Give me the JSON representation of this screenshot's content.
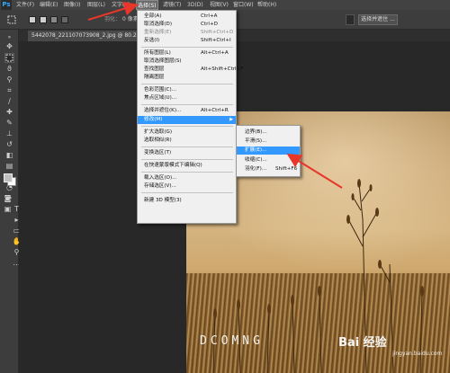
{
  "menubar": {
    "app_icon": "Ps",
    "items": [
      "文件(F)",
      "编辑(E)",
      "图像(I)",
      "图层(L)",
      "文字(Y)",
      "选择(S)",
      "滤镜(T)",
      "3D(D)",
      "视图(V)",
      "窗口(W)",
      "帮助(H)"
    ],
    "active_index": 5
  },
  "options_bar": {
    "feather_label": "羽化：",
    "feather_value": "0 像素",
    "select_and_mask_button": "选择并遮住 ..."
  },
  "document_tab": {
    "title": "5442078_221107073908_2.jpg @ 80.2..."
  },
  "select_menu": {
    "items": [
      {
        "label": "全部(A)",
        "shortcut": "Ctrl+A",
        "disabled": false
      },
      {
        "label": "取消选择(D)",
        "shortcut": "Ctrl+D",
        "disabled": false
      },
      {
        "label": "重新选择(E)",
        "shortcut": "Shift+Ctrl+D",
        "disabled": true
      },
      {
        "label": "反选(I)",
        "shortcut": "Shift+Ctrl+I",
        "disabled": false
      },
      {
        "label": "所有图层(L)",
        "shortcut": "Alt+Ctrl+A",
        "disabled": false
      },
      {
        "label": "取消选择图层(S)",
        "shortcut": "",
        "disabled": false
      },
      {
        "label": "查找图层",
        "shortcut": "Alt+Shift+Ctrl+F",
        "disabled": false
      },
      {
        "label": "隔离图层",
        "shortcut": "",
        "disabled": false
      },
      {
        "label": "色彩范围(C)...",
        "shortcut": "",
        "disabled": false
      },
      {
        "label": "焦点区域(U)...",
        "shortcut": "",
        "disabled": false
      },
      {
        "label": "选择并遮住(K)...",
        "shortcut": "Alt+Ctrl+R",
        "disabled": false
      },
      {
        "label": "修改(M)",
        "shortcut": "",
        "disabled": false,
        "submenu": true
      },
      {
        "label": "扩大选取(G)",
        "shortcut": "",
        "disabled": false
      },
      {
        "label": "选取相似(R)",
        "shortcut": "",
        "disabled": false
      },
      {
        "label": "变换选区(T)",
        "shortcut": "",
        "disabled": false
      },
      {
        "label": "在快速蒙版模式下编辑(Q)",
        "shortcut": "",
        "disabled": false
      },
      {
        "label": "载入选区(O)...",
        "shortcut": "",
        "disabled": false
      },
      {
        "label": "存储选区(V)...",
        "shortcut": "",
        "disabled": false
      },
      {
        "label": "新建 3D 模型(3)",
        "shortcut": "",
        "disabled": false
      }
    ],
    "highlighted_index": 11
  },
  "modify_submenu": {
    "items": [
      {
        "label": "边界(B)...",
        "shortcut": ""
      },
      {
        "label": "平滑(S)...",
        "shortcut": ""
      },
      {
        "label": "扩展(E)...",
        "shortcut": ""
      },
      {
        "label": "收缩(C)...",
        "shortcut": ""
      },
      {
        "label": "羽化(F)...",
        "shortcut": "Shift+F6"
      }
    ],
    "highlighted_index": 2
  },
  "canvas": {
    "watermark": "DCOMNG",
    "brand_text": "Bai 经验",
    "brand_url": "jingyan.baidu.com"
  },
  "colors": {
    "accent_highlight": "#3399ff",
    "annotation_arrow": "#e8362a"
  }
}
